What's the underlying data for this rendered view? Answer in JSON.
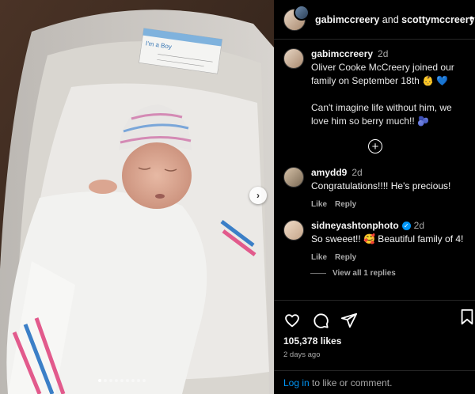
{
  "photo": {
    "tag_line1": "I'm a Boy",
    "dots_count": 9,
    "active_dot": 0
  },
  "header": {
    "user1": "gabimccreery",
    "joiner": " and ",
    "user2": "scottymccreery",
    "more": "•"
  },
  "post": {
    "username": "gabimccreery",
    "time": "2d",
    "caption1": "Oliver Cooke McCreery joined our family on September 18th 👶 💙",
    "caption2": "Can't imagine life without him, we love him so berry much!! 🫐"
  },
  "comments": [
    {
      "username": "amydd9",
      "time": "2d",
      "text": "Congratulations!!!! He's precious!",
      "like": "Like",
      "reply": "Reply"
    },
    {
      "username": "sidneyashtonphoto",
      "verified": true,
      "time": "2d",
      "text": "So sweeet!! 🥰 Beautiful family of 4!",
      "like": "Like",
      "reply": "Reply",
      "view_replies": "View all 1 replies"
    }
  ],
  "actions": {
    "likes": "105,378 likes",
    "ago": "2 days ago"
  },
  "login": {
    "link": "Log in",
    "rest": " to like or comment."
  }
}
